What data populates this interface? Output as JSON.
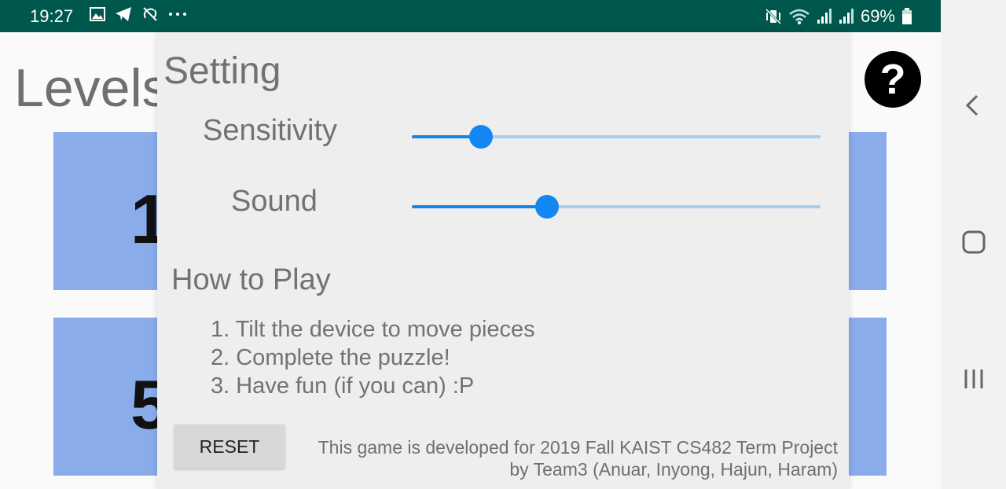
{
  "status_bar": {
    "time": "19:27",
    "left_icons": [
      "image-icon",
      "telegram-icon",
      "sync-off-icon",
      "more-icon"
    ],
    "right_icons": [
      "vibrate-icon",
      "wifi-icon",
      "signal-icon",
      "signal-icon",
      "battery-icon"
    ],
    "battery": "69%",
    "background_color": "#00574b"
  },
  "app": {
    "title": "Levels",
    "help_symbol": "?",
    "tiles": [
      {
        "label": "1"
      },
      {
        "label": "5"
      }
    ],
    "tile_color": "#8aaceb"
  },
  "dialog": {
    "title": "Setting",
    "sensitivity_label": "Sensitivity",
    "sensitivity_value": 0.17,
    "sound_label": "Sound",
    "sound_value": 0.33,
    "how_to_play_title": "How to Play",
    "steps": [
      "1. Tilt the device to move pieces",
      "2. Complete the puzzle!",
      "3. Have fun (if you can) :P"
    ],
    "reset_label": "RESET",
    "credit_line1": "This game is developed for 2019 Fall KAIST CS482 Term Project",
    "credit_line2": "by Team3 (Anuar, Inyong, Hajun, Haram)",
    "accent_color": "#1287f2"
  }
}
